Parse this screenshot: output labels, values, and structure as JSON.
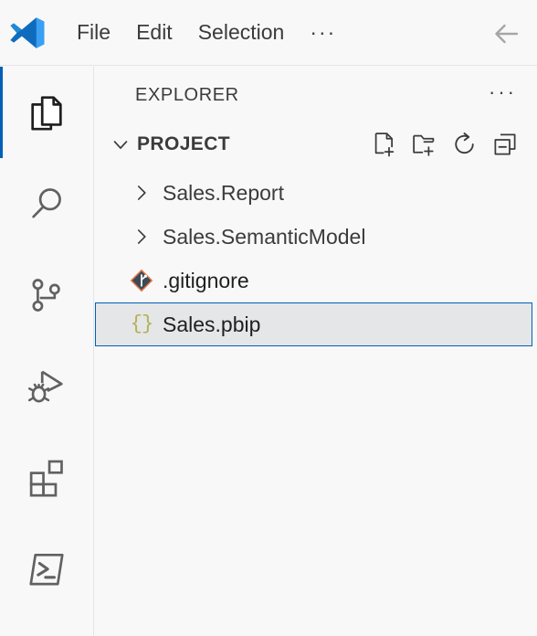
{
  "window": {
    "app_logo": "vscode-logo",
    "back_icon": "arrow-left-icon"
  },
  "menubar": {
    "items": [
      {
        "label": "File",
        "name": "menu-file"
      },
      {
        "label": "Edit",
        "name": "menu-edit"
      },
      {
        "label": "Selection",
        "name": "menu-selection"
      }
    ],
    "overflow_label": "···"
  },
  "activitybar": {
    "items": [
      {
        "name": "activitybar-explorer",
        "icon": "files-icon",
        "active": true
      },
      {
        "name": "activitybar-search",
        "icon": "search-icon",
        "active": false
      },
      {
        "name": "activitybar-source-control",
        "icon": "source-control-icon",
        "active": false
      },
      {
        "name": "activitybar-run-debug",
        "icon": "run-and-debug-icon",
        "active": false
      },
      {
        "name": "activitybar-extensions",
        "icon": "extensions-icon",
        "active": false
      },
      {
        "name": "activitybar-terminal",
        "icon": "terminal-icon",
        "active": false
      }
    ]
  },
  "sidebar": {
    "title": "EXPLORER",
    "views_more_label": "···",
    "section": {
      "title": "PROJECT",
      "expanded": true,
      "actions": [
        {
          "name": "new-file-button",
          "icon": "new-file-icon"
        },
        {
          "name": "new-folder-button",
          "icon": "new-folder-icon"
        },
        {
          "name": "refresh-explorer-button",
          "icon": "refresh-icon"
        },
        {
          "name": "collapse-folders-button",
          "icon": "collapse-all-icon"
        }
      ]
    },
    "tree": [
      {
        "label": "Sales.Report",
        "kind": "folder",
        "expanded": false,
        "icon": "chevron-right-icon",
        "selected": false
      },
      {
        "label": "Sales.SemanticModel",
        "kind": "folder",
        "expanded": false,
        "icon": "chevron-right-icon",
        "selected": false
      },
      {
        "label": ".gitignore",
        "kind": "file",
        "icon": "git-file-icon",
        "selected": false
      },
      {
        "label": "Sales.pbip",
        "kind": "file",
        "icon": "json-file-icon",
        "selected": true
      }
    ]
  },
  "colors": {
    "accent": "#005fb8",
    "selection_border": "#0060b8",
    "selection_background": "#e4e6e8",
    "background": "#f8f8f8",
    "foreground": "#3b3b3b",
    "json_icon": "#b5b14f",
    "git_icon": "#e8774b"
  }
}
